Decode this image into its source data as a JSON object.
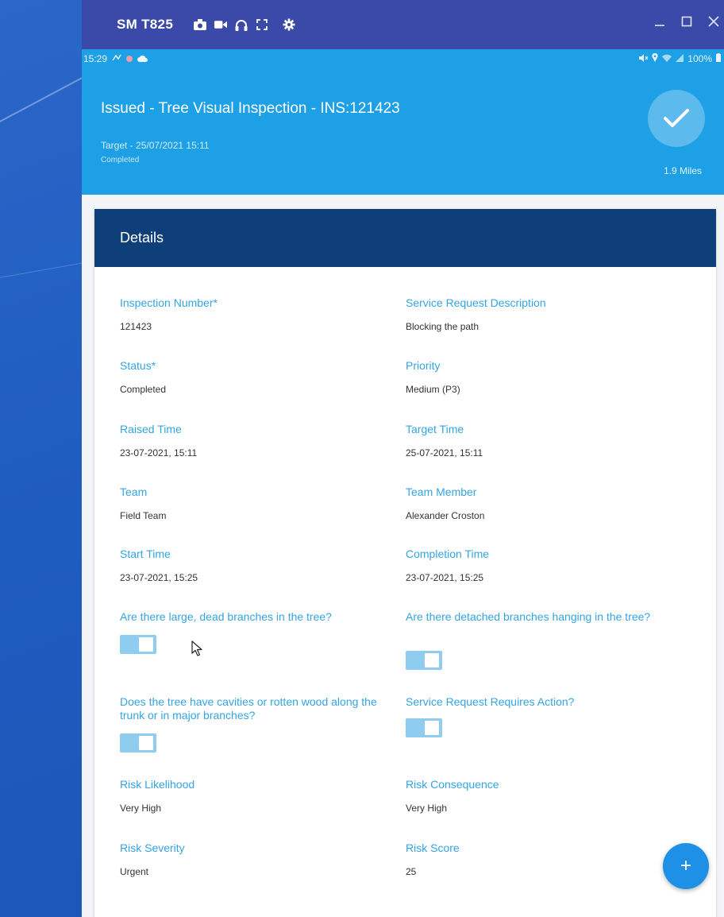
{
  "window": {
    "device_name": "SM T825",
    "icons": [
      "camera-icon",
      "video-icon",
      "headset-icon",
      "fullscreen-icon",
      "settings-icon"
    ],
    "controls": [
      "minimize-icon",
      "maximize-icon",
      "close-icon"
    ]
  },
  "statusbar": {
    "time": "15:29",
    "battery": "100%"
  },
  "header": {
    "title": "Issued - Tree Visual Inspection - INS:121423",
    "target": "Target - 25/07/2021 15:11",
    "status": "Completed",
    "distance": "1.9 Miles"
  },
  "details": {
    "title": "Details",
    "fields": {
      "inspection_number": {
        "label": "Inspection Number*",
        "value": "121423"
      },
      "service_request_description": {
        "label": "Service Request Description",
        "value": "Blocking the path"
      },
      "status": {
        "label": "Status*",
        "value": "Completed"
      },
      "priority": {
        "label": "Priority",
        "value": "Medium (P3)"
      },
      "raised_time": {
        "label": "Raised Time",
        "value": "23-07-2021, 15:11"
      },
      "target_time": {
        "label": "Target Time",
        "value": "25-07-2021, 15:11"
      },
      "team": {
        "label": "Team",
        "value": "Field Team"
      },
      "team_member": {
        "label": "Team Member",
        "value": "Alexander Croston"
      },
      "start_time": {
        "label": "Start Time",
        "value": "23-07-2021, 15:25"
      },
      "completion_time": {
        "label": "Completion Time",
        "value": "23-07-2021, 15:25"
      },
      "dead_branches": {
        "label": "Are there large, dead branches in the tree?",
        "checked": true
      },
      "detached_branches": {
        "label": "Are there detached branches hanging in the tree?",
        "checked": true
      },
      "cavities": {
        "label": "Does the tree have cavities or rotten wood along the trunk or in major branches?",
        "checked": true
      },
      "requires_action": {
        "label": "Service Request Requires Action?",
        "checked": true
      },
      "risk_likelihood": {
        "label": "Risk Likelihood",
        "value": "Very High"
      },
      "risk_consequence": {
        "label": "Risk Consequence",
        "value": "Very High"
      },
      "risk_severity": {
        "label": "Risk Severity",
        "value": "Urgent"
      },
      "risk_score": {
        "label": "Risk Score",
        "value": "25"
      }
    }
  },
  "fab": {
    "label": "+"
  }
}
